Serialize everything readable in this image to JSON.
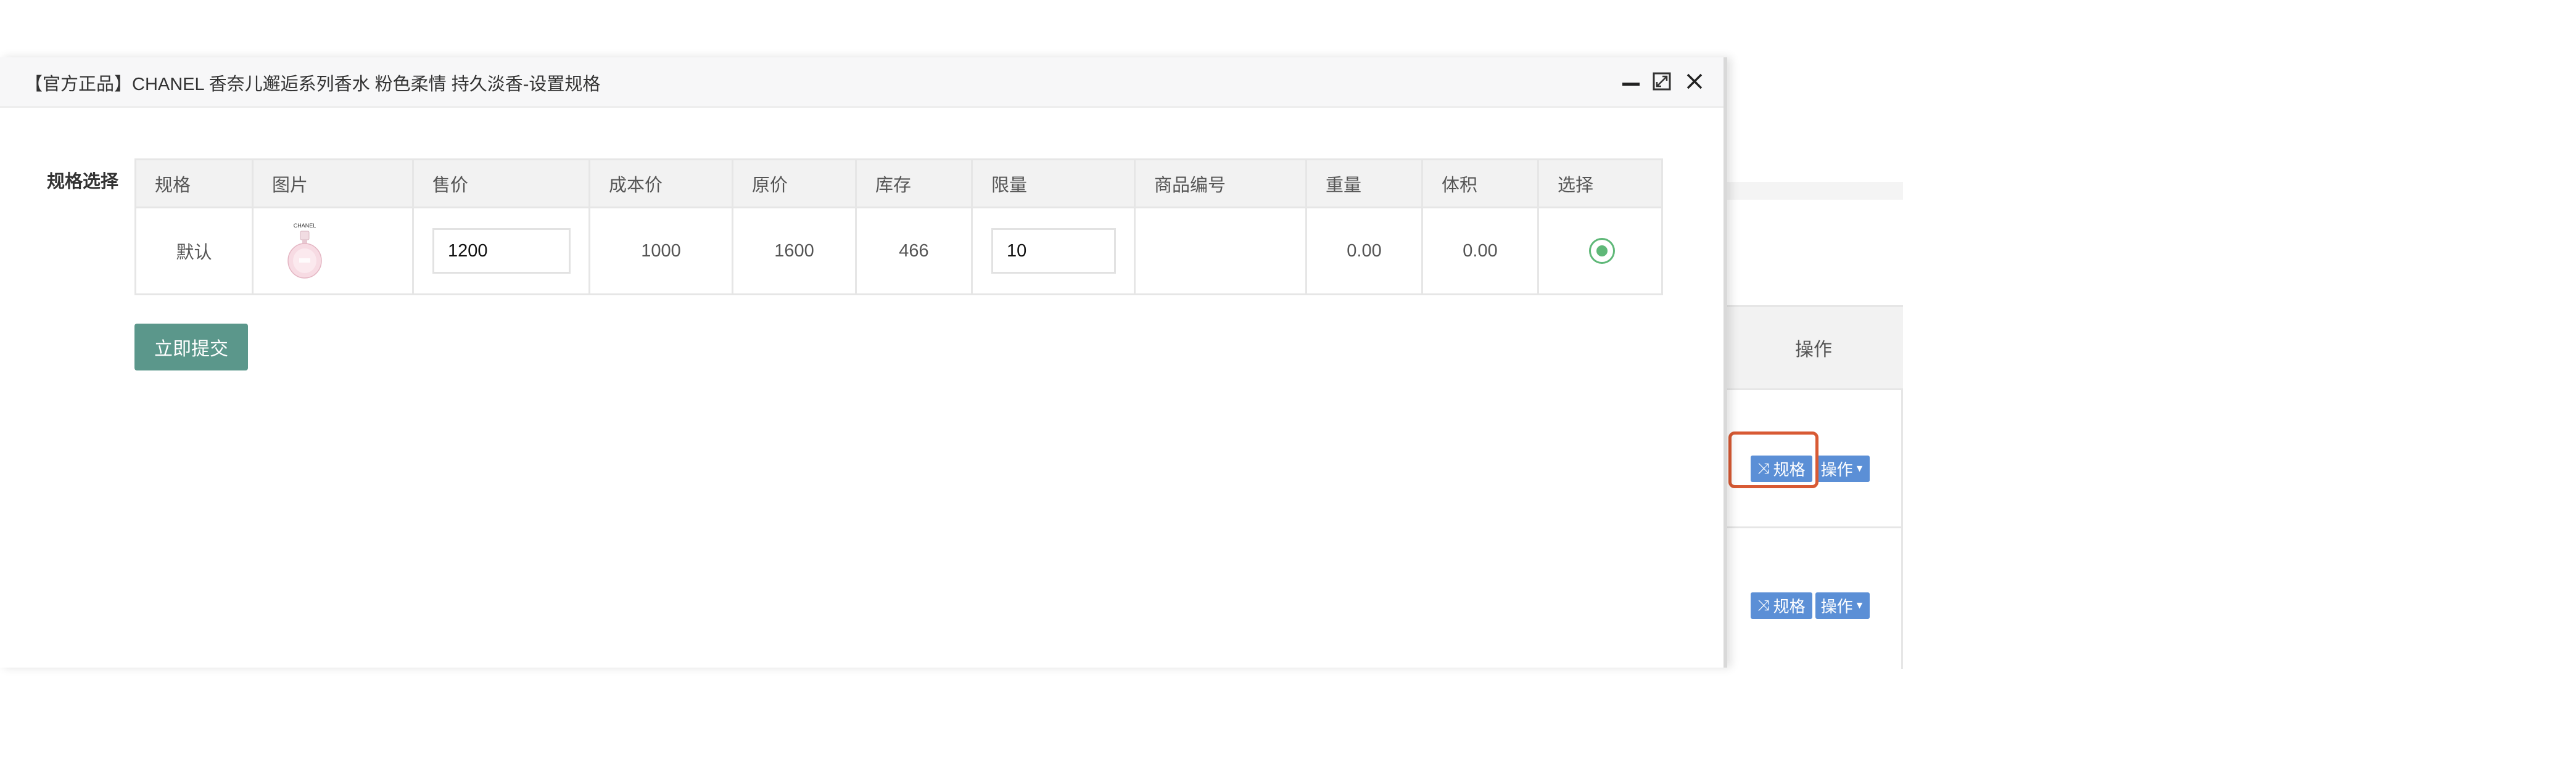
{
  "modal": {
    "title": "【官方正品】CHANEL 香奈儿邂逅系列香水 粉色柔情 持久淡香-设置规格",
    "icons": [
      "minimize-icon",
      "maximize-icon",
      "close-icon"
    ],
    "field_label": "规格选择",
    "table": {
      "headers": [
        "规格",
        "图片",
        "售价",
        "成本价",
        "原价",
        "库存",
        "限量",
        "商品编号",
        "重量",
        "体积",
        "选择"
      ],
      "rows": [
        {
          "spec": "默认",
          "image_brand": "CHANEL",
          "price": "1200",
          "cost": "1000",
          "original_price": "1600",
          "stock": "466",
          "limit": "10",
          "sku": "",
          "weight": "0.00",
          "volume": "0.00",
          "selected": true
        }
      ]
    },
    "submit_label": "立即提交"
  },
  "background_table": {
    "header": "操作",
    "rows": [
      {
        "spec_button": "规格",
        "op_button": "操作"
      },
      {
        "spec_button": "规格",
        "op_button": "操作"
      }
    ]
  },
  "colors": {
    "button_blue": "#5b8fd6",
    "submit_green": "#5b978b",
    "radio_green": "#5fb878",
    "annotation_orange": "#d85a34"
  }
}
